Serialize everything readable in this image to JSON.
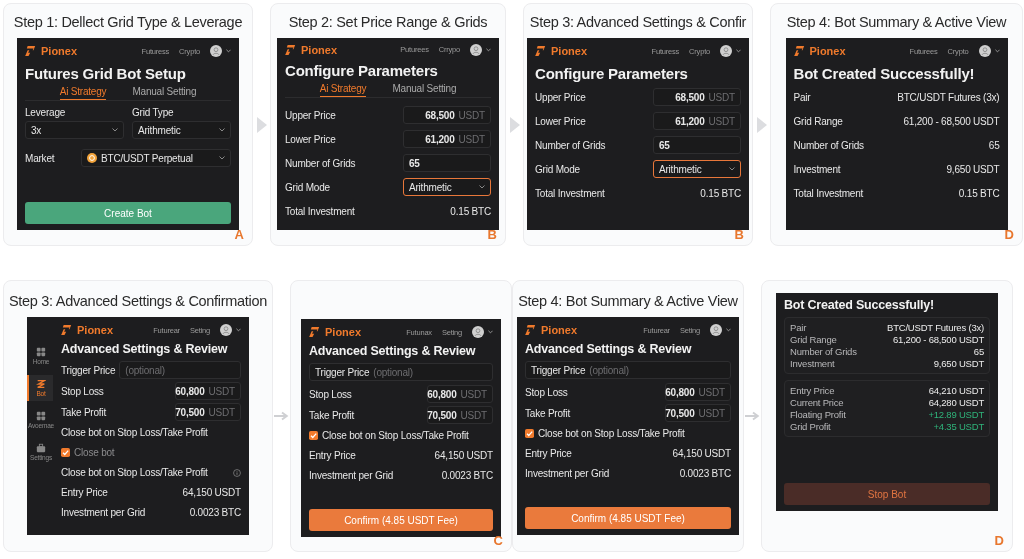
{
  "top_row": [
    {
      "title": "Step 1: Dellect Grid Type & Leverage",
      "letter": "A",
      "screen": {
        "header": {
          "brand": "Pionex",
          "nav": [
            "Futuress",
            "Crypto"
          ]
        },
        "heading": "Futures Grid Bot Setup",
        "tabs": [
          {
            "label": "Ai Strategy",
            "selected": true
          },
          {
            "label": "Manual Setting",
            "selected": false
          }
        ],
        "rows": [
          {
            "kind": "select-pair",
            "items": [
              {
                "label": "Leverage",
                "value": "3x"
              },
              {
                "label": "Grid Type",
                "value": "Arithmetic"
              }
            ]
          },
          {
            "kind": "select",
            "label": "Market",
            "value": "BTC/USDT Perpetual",
            "coin": true,
            "focused": false
          }
        ],
        "button": {
          "label": "Create Bot",
          "kind": "create"
        }
      }
    },
    {
      "title": "Step 2: Set Price Range & Grids",
      "letter": "B",
      "screen": {
        "header": {
          "brand": "Pionex",
          "nav": [
            "Puturees",
            "Crrypo"
          ]
        },
        "heading": "Configure Parameters",
        "tabs": [
          {
            "label": "Ai Strategy",
            "selected": true
          },
          {
            "label": "Manual Setting",
            "selected": false
          }
        ],
        "rows": [
          {
            "kind": "input",
            "label": "Upper Price",
            "value": "68,500",
            "unit": "USDT"
          },
          {
            "kind": "input",
            "label": "Lower Price",
            "value": "61,200",
            "unit": "USDT"
          },
          {
            "kind": "input",
            "label": "Number of Grids",
            "value": "65"
          },
          {
            "kind": "select",
            "label": "Grid Mode",
            "value": "Arithmetic",
            "coin": false,
            "focused": true
          },
          {
            "kind": "info",
            "label": "Total Investment",
            "value": "0.15 BTC"
          }
        ]
      }
    },
    {
      "title": "Step 3: Advanced Settings & Confir",
      "letter": "B",
      "screen": {
        "header": {
          "brand": "Pionex",
          "nav": [
            "Futuress",
            "Crypto"
          ]
        },
        "heading": "Configure Parameters",
        "rows": [
          {
            "kind": "input",
            "label": "Upper Price",
            "value": "68,500",
            "unit": "USDT"
          },
          {
            "kind": "input",
            "label": "Lower Price",
            "value": "61,200",
            "unit": "USDT"
          },
          {
            "kind": "input",
            "label": "Number of Grids",
            "value": "65"
          },
          {
            "kind": "select",
            "label": "Grid Mode",
            "value": "Arithmetic",
            "coin": false,
            "focused": true
          },
          {
            "kind": "info",
            "label": "Total Investment",
            "value": "0.15 BTC"
          }
        ]
      }
    },
    {
      "title": "Step 4: Bot Summary & Active View",
      "letter": "D",
      "screen": {
        "header": {
          "brand": "Pionex",
          "nav": [
            "Futurees",
            "Crypto"
          ]
        },
        "heading": "Bot Created Successfully!",
        "rows": [
          {
            "kind": "info",
            "label": "Pair",
            "value": "BTC/USDT Futures (3x)"
          },
          {
            "kind": "info",
            "label": "Grid Range",
            "value": "61,200 - 68,500 USDT"
          },
          {
            "kind": "info",
            "label": "Number of Grids",
            "value": "65"
          },
          {
            "kind": "info",
            "label": "Investment",
            "value": "9,650 USDT"
          },
          {
            "kind": "info",
            "label": "Total Investment",
            "value": "0.15 BTC"
          }
        ]
      }
    }
  ],
  "bottom_row": [
    {
      "title": "Step 3: Advanced Settings & Confirmation",
      "screen": {
        "header": {
          "brand": "Pionex",
          "nav": [
            "Futurear",
            "Seting"
          ]
        },
        "sidebar": [
          {
            "label": "Home",
            "selected": false
          },
          {
            "label": "Bot",
            "selected": true
          },
          {
            "label": "Avoemae",
            "selected": false
          },
          {
            "label": "Settings",
            "selected": false
          }
        ],
        "heading": "Advanced Settings & Review",
        "rows": [
          {
            "kind": "input",
            "label": "Trigger Price",
            "placeholder": "(optional)"
          },
          {
            "kind": "input",
            "label": "Stop Loss",
            "value": "60,800",
            "unit": "USDT"
          },
          {
            "kind": "input",
            "label": "Take Profit",
            "value": "70,500",
            "unit": "USDT"
          },
          {
            "kind": "text",
            "label": "Close bot on Stop Loss/Take Profit",
            "info": false
          },
          {
            "kind": "checkbox",
            "label": "Close bot",
            "checked": true,
            "disabled": true
          },
          {
            "kind": "text",
            "label": "Close bot on Stop Loss/Take Profit",
            "info": true
          },
          {
            "kind": "info",
            "label": "Entry Price",
            "value": "64,150  USDT"
          },
          {
            "kind": "info",
            "label": "Investment per Grid",
            "value": "0.0023  BTC"
          }
        ]
      }
    },
    {
      "letter": "C",
      "screen": {
        "header": {
          "brand": "Pionex",
          "nav": [
            "Futunax",
            "Seting"
          ]
        },
        "heading": "Advanced Settings & Review",
        "rows": [
          {
            "kind": "inset-input",
            "label": "Trigger Price",
            "placeholder": "(optional)"
          },
          {
            "kind": "input",
            "label": "Stop Loss",
            "value": "60,800",
            "unit": "USDT"
          },
          {
            "kind": "input",
            "label": "Take Profit",
            "value": "70,500",
            "unit": "USDT"
          },
          {
            "kind": "checkbox",
            "label": "Close bot on Stop Loss/Take Profit",
            "checked": true,
            "disabled": false
          },
          {
            "kind": "info",
            "label": "Entry Price",
            "value": "64,150  USDT"
          },
          {
            "kind": "info",
            "label": "Investment per Grid",
            "value": "0.0023  BTC"
          }
        ],
        "button": {
          "label": "Confirm (4.85 USDT Fee)",
          "kind": "confirm"
        }
      }
    },
    {
      "title": "Step 4: Bot Summary & Active View",
      "screen": {
        "header": {
          "brand": "Pionex",
          "nav": [
            "Futurear",
            "Seting"
          ]
        },
        "heading": "Advanced Settings & Review",
        "rows": [
          {
            "kind": "inset-input",
            "label": "Trigger Price",
            "placeholder": "(optional)"
          },
          {
            "kind": "input",
            "label": "Stop Loss",
            "value": "60,800",
            "unit": "USDT"
          },
          {
            "kind": "input",
            "label": "Take Profit",
            "value": "70,500",
            "unit": "USDT"
          },
          {
            "kind": "checkbox",
            "label": "Close bot on Stop Loss/Take Profit",
            "checked": true,
            "disabled": false
          },
          {
            "kind": "info",
            "label": "Entry Price",
            "value": "64,150  USDT"
          },
          {
            "kind": "info",
            "label": "Investment per Grid",
            "value": "0.0023  BTC"
          }
        ],
        "button": {
          "label": "Confirm (4.85 USDT Fee)",
          "kind": "confirm"
        }
      }
    },
    {
      "letter": "D",
      "screen": {
        "heading": "Bot Created Successfully!",
        "rows": [
          {
            "kind": "group",
            "items": [
              {
                "label": "Pair",
                "value": "BTC/USDT Futures (3x)",
                "positive": false
              },
              {
                "label": "Grid Range",
                "value": "61,200 - 68,500 USDT",
                "positive": false
              },
              {
                "label": "Number of Grids",
                "value": "65",
                "positive": false
              },
              {
                "label": "Investment",
                "value": "9,650 USDT",
                "positive": false
              }
            ]
          },
          {
            "kind": "group",
            "items": [
              {
                "label": "Entry Price",
                "value": "64,210 USDT",
                "positive": false
              },
              {
                "label": "Current Price",
                "value": "64,280 USDT",
                "positive": false
              },
              {
                "label": "Floating Profit",
                "value": "+12.89 USDT",
                "positive": true
              },
              {
                "label": "Grid Profit",
                "value": "+4.35 USDT",
                "positive": true
              }
            ]
          }
        ],
        "button": {
          "label": "Stop Bot",
          "kind": "stop"
        }
      }
    }
  ]
}
